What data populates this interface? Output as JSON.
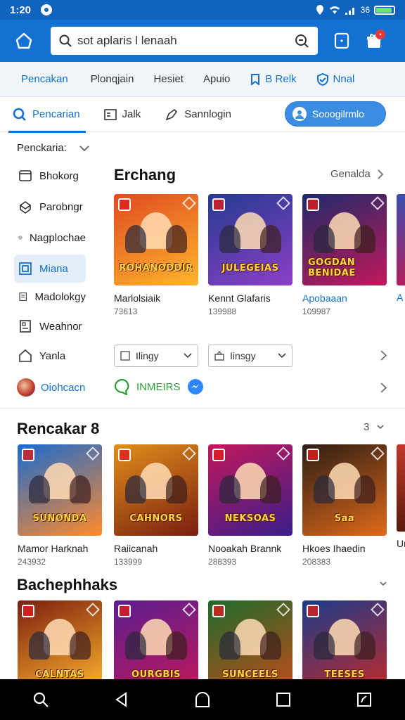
{
  "status": {
    "time": "1:20",
    "signal_text": "36",
    "battery_level": 0.85
  },
  "appbar": {
    "search_value": "sot aplaris l lenaah"
  },
  "categories": [
    {
      "label": "Pencakan",
      "style": "active"
    },
    {
      "label": "Plonqjain",
      "style": "plain"
    },
    {
      "label": "Hesiet",
      "style": "plain"
    },
    {
      "label": "Apuio",
      "style": "plain"
    },
    {
      "label": "B Relk",
      "style": "blue"
    },
    {
      "label": "Nnal",
      "style": "blue"
    }
  ],
  "tabs": {
    "search": "Pencarian",
    "jalk": "Jalk",
    "sannlogin": "Sannlogin",
    "pill": "Sooogilrmlo"
  },
  "sidebar": {
    "header": "Penckaria:",
    "items": [
      {
        "label": "Bhokorg",
        "icon": "window-icon"
      },
      {
        "label": "Parobngr",
        "icon": "box-icon"
      },
      {
        "label": "Nagplochae",
        "icon": "cube-icon"
      },
      {
        "label": "Miana",
        "icon": "frame-icon"
      },
      {
        "label": "Madolokgy",
        "icon": "document-icon"
      },
      {
        "label": "Weahnor",
        "icon": "grid-doc-icon"
      },
      {
        "label": "Yanla",
        "icon": "home-outline-icon"
      }
    ]
  },
  "featured": {
    "title": "Erchang",
    "more": "Genalda",
    "cards": [
      {
        "name": "Marlolsiaik",
        "meta": "73613",
        "banner": "ROHANODDIR",
        "bg": "#e04a1f",
        "bg2": "#ffb52e",
        "blue": false
      },
      {
        "name": "Kennt Glafaris",
        "meta": "139988",
        "banner": "JULEGEIAS",
        "bg": "#243b8f",
        "bg2": "#8c3fc7",
        "blue": false
      },
      {
        "name": "Apobaaan",
        "meta": "109987",
        "banner": "GOGDAN BENIDAE",
        "bg": "#1e2a6a",
        "bg2": "#c2185b",
        "blue": true
      }
    ],
    "peek_letter": "A",
    "dropdowns": [
      "Ilingy",
      "Iinsgy"
    ]
  },
  "share": {
    "first": "Oiohcacn",
    "second": "INMEIRS"
  },
  "section2": {
    "title": "Rencakar 8",
    "count": "3",
    "cards": [
      {
        "name": "Mamor Harknah",
        "meta": "243932",
        "banner": "SUNONDA",
        "bg": "#1a6ad0",
        "bg2": "#ff8a2a"
      },
      {
        "name": "Raiicanah",
        "meta": "133999",
        "banner": "CAHNORS",
        "bg": "#e08f1c",
        "bg2": "#7a1e0f"
      },
      {
        "name": "Nooakah Brannk",
        "meta": "288393",
        "banner": "NEKSOAS",
        "bg": "#c2185b",
        "bg2": "#3a1d8a"
      },
      {
        "name": "Hkoes Ihaedin",
        "meta": "208383",
        "banner": "Saa",
        "bg": "#2b1d14",
        "bg2": "#e06a1a"
      }
    ],
    "peek_letter": "Ur"
  },
  "section3": {
    "title": "Bachephhaks",
    "cards": [
      {
        "banner": "CALNTAS",
        "bg": "#7a1e0f",
        "bg2": "#ffb52e"
      },
      {
        "banner": "OURGBIS",
        "bg": "#5a1e8f",
        "bg2": "#c2185b"
      },
      {
        "banner": "SUNCEELS",
        "bg": "#1d6b2a",
        "bg2": "#c24b1a"
      },
      {
        "banner": "TEESES",
        "bg": "#1a3a8a",
        "bg2": "#c22a2a"
      }
    ]
  },
  "colors": {
    "accent": "#1371d3",
    "statusbar": "#0f64c0"
  }
}
